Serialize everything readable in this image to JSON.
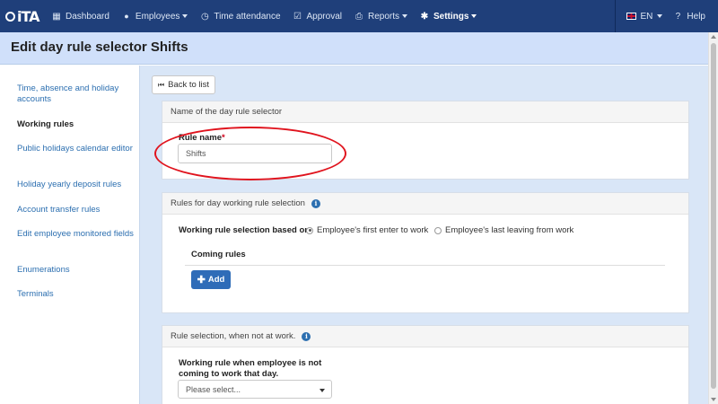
{
  "nav": {
    "logo_text": "iTA",
    "items": [
      {
        "label": "Dashboard",
        "icon": "grid-icon",
        "glyph": "▦"
      },
      {
        "label": "Employees",
        "icon": "user-icon",
        "glyph": "👤",
        "dropdown": true
      },
      {
        "label": "Time attendance",
        "icon": "clock-icon",
        "glyph": "◷"
      },
      {
        "label": "Approval",
        "icon": "checkbox-icon",
        "glyph": "☑"
      },
      {
        "label": "Reports",
        "icon": "printer-icon",
        "glyph": "⎙",
        "dropdown": true
      },
      {
        "label": "Settings",
        "icon": "gear-icon",
        "glyph": "✱",
        "dropdown": true,
        "active": true
      }
    ],
    "language": "EN",
    "help": "Help",
    "help_glyph": "?"
  },
  "page": {
    "title": "Edit day rule selector Shifts",
    "back_label": "Back to list",
    "back_glyph": "⏮"
  },
  "sidebar": {
    "items": [
      {
        "label": "Time, absence and holiday accounts"
      },
      {
        "label": "Working rules",
        "active": true
      },
      {
        "label": "Public holidays calendar editor"
      },
      {
        "label": "Holiday yearly deposit rules"
      },
      {
        "label": "Account transfer rules"
      },
      {
        "label": "Edit employee monitored fields"
      },
      {
        "label": "Enumerations"
      },
      {
        "label": "Terminals"
      }
    ]
  },
  "panel_name": {
    "header": "Name of the day rule selector",
    "rule_name_label": "Rule name",
    "required_mark": "*",
    "rule_name_value": "Shifts"
  },
  "panel_rules": {
    "header": "Rules for day working rule selection",
    "info_glyph": "i",
    "selection_label": "Working rule selection based on",
    "options": [
      {
        "label": "Employee's first enter to work",
        "selected": true
      },
      {
        "label": "Employee's last leaving from work",
        "selected": false
      }
    ],
    "coming_rules_label": "Coming rules",
    "add_label": "Add",
    "add_glyph": "✚"
  },
  "panel_notwork": {
    "header": "Rule selection, when not at work.",
    "info_glyph": "i",
    "label": "Working rule when employee is not coming to work that day.",
    "select_placeholder": "Please select..."
  },
  "colors": {
    "nav_bg": "#1f3f7a",
    "header_bg": "#d0e0fa",
    "main_bg": "#d9e6f7",
    "link": "#2c6fb0",
    "primary_button": "#2f6cb8",
    "annotation": "#e0141e"
  }
}
